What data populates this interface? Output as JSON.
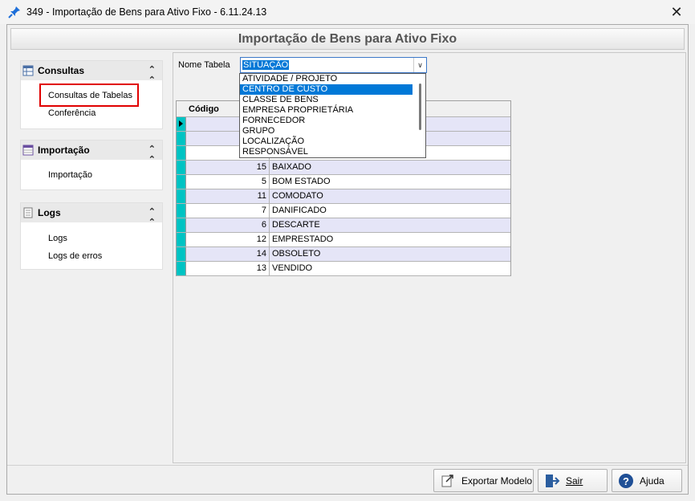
{
  "window": {
    "title": "349 - Importação de Bens para Ativo Fixo - 6.11.24.13",
    "close_glyph": "✕"
  },
  "header": {
    "title": "Importação de Bens para Ativo Fixo"
  },
  "sidebar": {
    "groups": [
      {
        "title": "Consultas",
        "icon": "table-icon",
        "items": [
          "Consultas de Tabelas",
          "Conferência"
        ]
      },
      {
        "title": "Importação",
        "icon": "calendar-icon",
        "items": [
          "Importação"
        ]
      },
      {
        "title": "Logs",
        "icon": "document-icon",
        "items": [
          "Logs",
          "Logs de erros"
        ]
      }
    ],
    "collapse_glyph": "⌃"
  },
  "form": {
    "nome_tabela_label": "Nome Tabela",
    "selected_table": "SITUAÇÃO"
  },
  "dropdown": {
    "options": [
      "ATIVIDADE / PROJETO",
      "CENTRO DE CUSTO",
      "CLASSE DE BENS",
      "EMPRESA PROPRIETÁRIA",
      "FORNECEDOR",
      "GRUPO",
      "LOCALIZAÇÃO",
      "RESPONSÁVEL"
    ],
    "highlighted": "CENTRO DE CUSTO"
  },
  "grid": {
    "columns": [
      "Código",
      ""
    ],
    "rows": [
      {
        "code": "",
        "desc": ""
      },
      {
        "code": "",
        "desc": ""
      },
      {
        "code": "",
        "desc": ""
      },
      {
        "code": "15",
        "desc": "BAIXADO"
      },
      {
        "code": "5",
        "desc": "BOM ESTADO"
      },
      {
        "code": "11",
        "desc": "COMODATO"
      },
      {
        "code": "7",
        "desc": "DANIFICADO"
      },
      {
        "code": "6",
        "desc": "DESCARTE"
      },
      {
        "code": "12",
        "desc": "EMPRESTADO"
      },
      {
        "code": "14",
        "desc": "OBSOLETO"
      },
      {
        "code": "13",
        "desc": "VENDIDO"
      }
    ]
  },
  "footer": {
    "export_label": "Exportar Modelo",
    "exit_label": "Sair",
    "help_label": "Ajuda"
  },
  "colors": {
    "accent": "#0078d7",
    "highlight_border": "#e00000",
    "row_indicator": "#00c3c3",
    "row_alt": "#e5e5f7"
  }
}
